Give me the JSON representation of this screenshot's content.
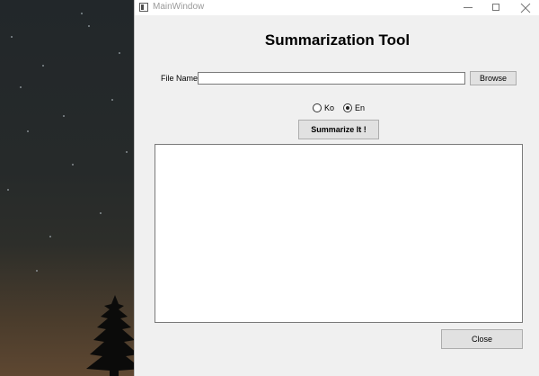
{
  "window": {
    "title": "MainWindow"
  },
  "app": {
    "heading": "Summarization Tool",
    "file_name_label": "File Name",
    "file_name_value": "",
    "browse_label": "Browse",
    "languages": [
      {
        "label": "Ko",
        "selected": false
      },
      {
        "label": "En",
        "selected": true
      }
    ],
    "summarize_label": "Summarize It !",
    "output_text": "",
    "close_label": "Close"
  },
  "colors": {
    "window_bg": "#f0f0f0",
    "button_bg": "#e1e1e1",
    "desktop_sky": "#262a2a",
    "desktop_horizon": "#5e4731"
  }
}
